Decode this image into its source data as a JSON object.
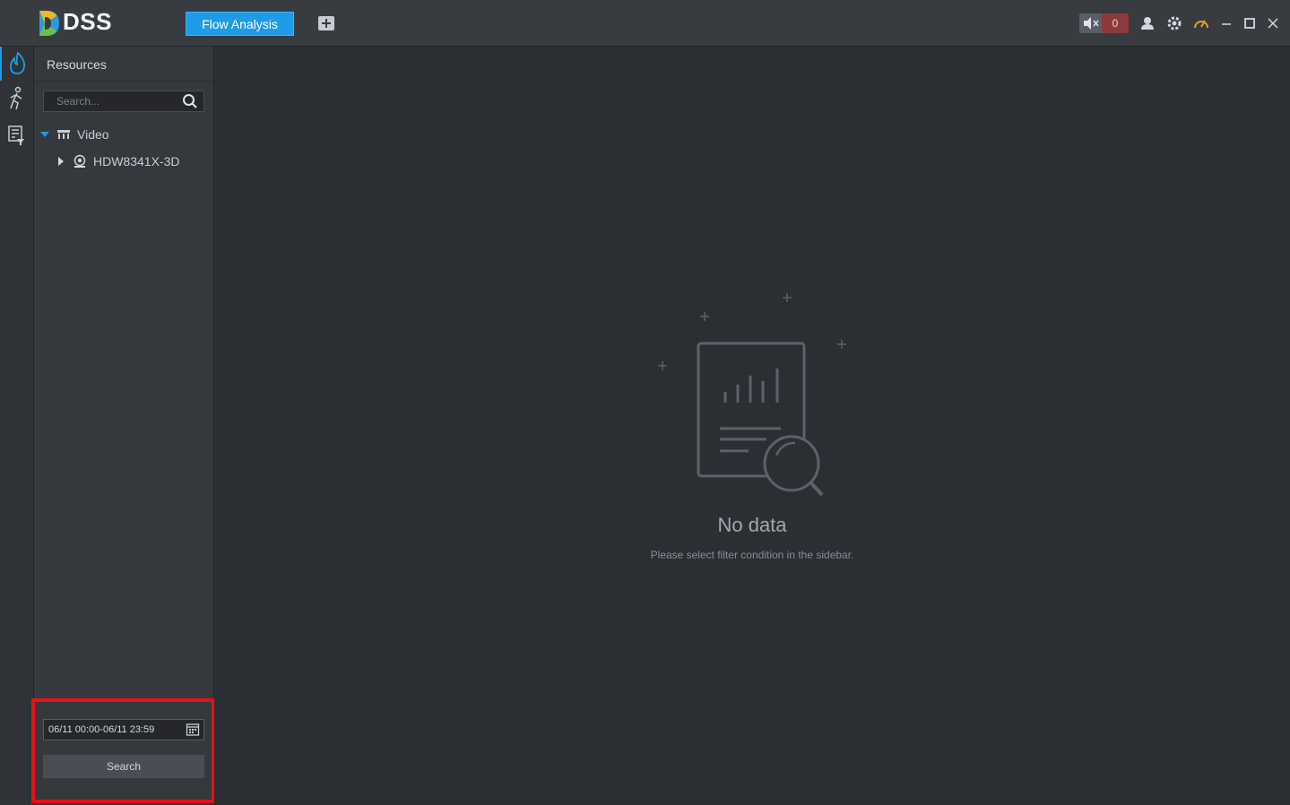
{
  "app": {
    "brand": "DSS",
    "active_tab": "Flow Analysis",
    "alarm_count": "0"
  },
  "sidebar": {
    "title": "Resources",
    "search_placeholder": "Search...",
    "tree": [
      {
        "label": "Video",
        "expanded": true
      },
      {
        "label": "HDW8341X-3D",
        "expanded": false
      }
    ],
    "time_range": "06/11 00:00-06/11 23:59",
    "search_button": "Search"
  },
  "main": {
    "empty_title": "No data",
    "empty_hint": "Please select filter condition in the sidebar."
  },
  "colors": {
    "accent": "#1e9ce8",
    "alarm": "#8e3a3a",
    "highlight": "#e3121a",
    "perf_icon": "#e8a020"
  }
}
